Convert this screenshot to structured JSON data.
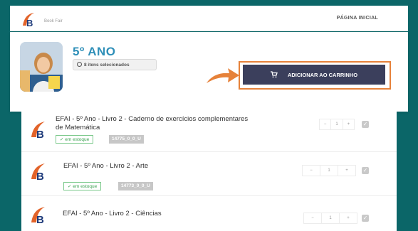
{
  "header_bar": {
    "brand": "Book Fair",
    "home_link": "PÁGINA INICIAL"
  },
  "product": {
    "title": "5º ANO",
    "selected_count": "8 itens selecionados",
    "add_to_cart": "ADICIONAR AO CARRINHO"
  },
  "colors": {
    "teal_frame": "#0b6668",
    "title_blue": "#2f8fb8",
    "button_dark": "#3b3f5c",
    "highlight_orange": "#e6823a"
  },
  "items": [
    {
      "name_line1": "EFAI - 5º Ano - Livro 2 - Caderno de exercícios complementares",
      "name_line2": "de Matemática",
      "stock": "em estoque",
      "sku": "14775_0_0_U",
      "qty": "1",
      "minus": "−",
      "plus": "+"
    },
    {
      "name_line1": "EFAI - 5º Ano - Livro 2 - Arte",
      "stock": "em estoque",
      "sku": "14773_0_0_U",
      "qty": "1",
      "minus": "−",
      "plus": "+"
    },
    {
      "name_line1": "EFAI - 5º Ano - Livro 2 - Ciências",
      "qty": "1",
      "minus": "−",
      "plus": "+"
    }
  ]
}
